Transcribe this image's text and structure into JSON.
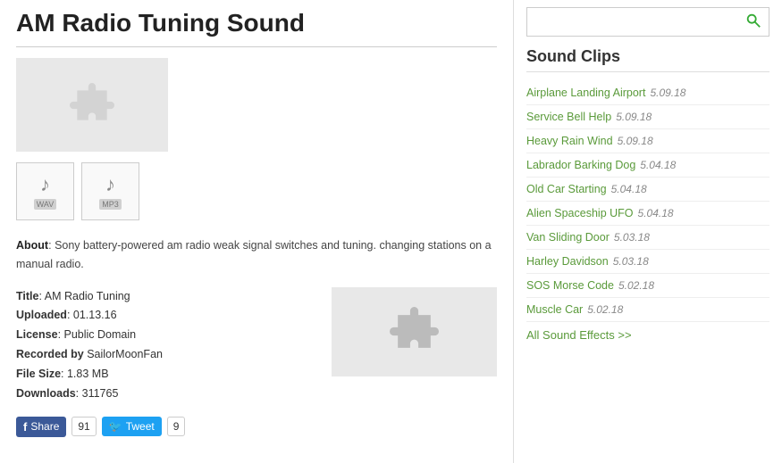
{
  "header": {
    "title": "AM Radio Tuning Sound"
  },
  "search": {
    "placeholder": ""
  },
  "about_text": "Sony battery-powered am radio weak signal switches and tuning. changing stations on a manual radio.",
  "meta": {
    "title_label": "Title",
    "title_value": "AM Radio Tuning",
    "uploaded_label": "Uploaded",
    "uploaded_value": "01.13.16",
    "license_label": "License",
    "license_value": "Public Domain",
    "recorded_label": "Recorded by",
    "recorded_value": "SailorMoonFan",
    "filesize_label": "File Size",
    "filesize_value": "1.83 MB",
    "downloads_label": "Downloads",
    "downloads_value": "311765"
  },
  "social": {
    "fb_label": "Share",
    "fb_count": "91",
    "tw_label": "Tweet",
    "tw_count": "9"
  },
  "sidebar": {
    "section_title": "Sound Clips",
    "clips": [
      {
        "name": "Airplane Landing Airport",
        "date": "5.09.18"
      },
      {
        "name": "Service Bell Help",
        "date": "5.09.18"
      },
      {
        "name": "Heavy Rain Wind",
        "date": "5.09.18"
      },
      {
        "name": "Labrador Barking Dog",
        "date": "5.04.18"
      },
      {
        "name": "Old Car Starting",
        "date": "5.04.18"
      },
      {
        "name": "Alien Spaceship UFO",
        "date": "5.04.18"
      },
      {
        "name": "Van Sliding Door",
        "date": "5.03.18"
      },
      {
        "name": "Harley Davidson",
        "date": "5.03.18"
      },
      {
        "name": "SOS Morse Code",
        "date": "5.02.18"
      },
      {
        "name": "Muscle Car",
        "date": "5.02.18"
      }
    ],
    "all_label": "All Sound Effects >>"
  },
  "files": [
    {
      "type": "WAV",
      "icon": "♪"
    },
    {
      "type": "MP3",
      "icon": "♪"
    }
  ]
}
